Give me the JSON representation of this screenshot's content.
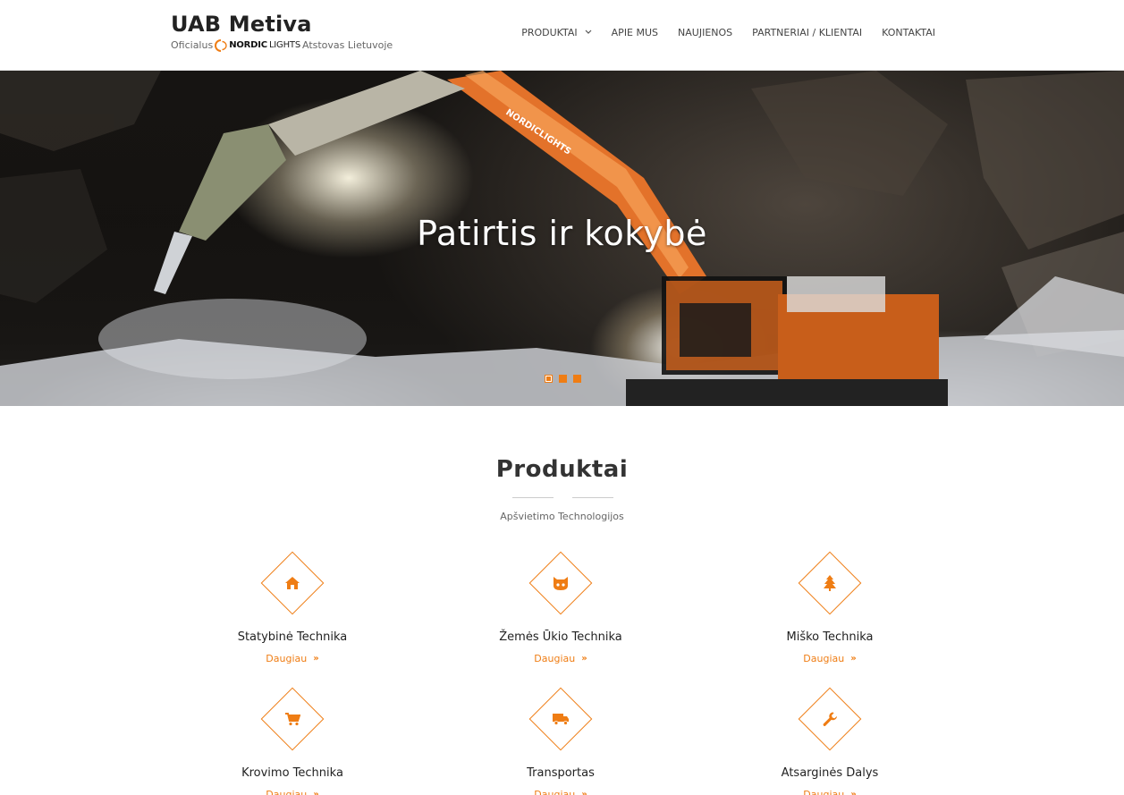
{
  "brand": {
    "title": "UAB Metiva",
    "sub_prefix": "Oficialus",
    "partner_bold": "NORDIC",
    "partner_light": "LIGHTS",
    "sub_suffix": "Atstovas Lietuvoje"
  },
  "nav": {
    "items": [
      {
        "label": "PRODUKTAI",
        "has_dropdown": true
      },
      {
        "label": "APIE MUS"
      },
      {
        "label": "NAUJIENOS"
      },
      {
        "label": "PARTNERIAI / KLIENTAI"
      },
      {
        "label": "KONTAKTAI"
      }
    ]
  },
  "hero": {
    "title": "Patirtis ir kokybė",
    "slide_count": 3,
    "active_slide": 1,
    "machine_label": "NORDICLIGHTS"
  },
  "products": {
    "title": "Produktai",
    "subtitle": "Apšvietimo Technologijos",
    "more_label": "Daugiau",
    "items": [
      {
        "title": "Statybinė Technika",
        "icon": "home-icon"
      },
      {
        "title": "Žemės Ūkio Technika",
        "icon": "github-cat-icon"
      },
      {
        "title": "Miško Technika",
        "icon": "tree-icon"
      },
      {
        "title": "Krovimo Technika",
        "icon": "shopping-cart-icon"
      },
      {
        "title": "Transportas",
        "icon": "truck-icon"
      },
      {
        "title": "Atsarginės Dalys",
        "icon": "wrench-icon"
      }
    ]
  },
  "colors": {
    "accent": "#ef7d14",
    "text": "#333333"
  }
}
